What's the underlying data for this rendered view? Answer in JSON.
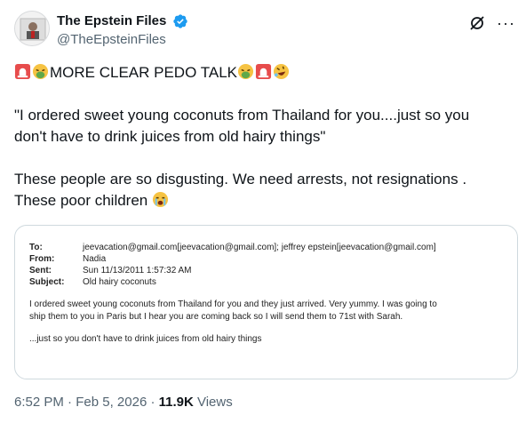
{
  "author": {
    "display_name": "The Epstein Files",
    "handle": "@TheEpsteinFiles",
    "verified_icon": "verified-badge-icon",
    "badge_color": "#1d9bf0"
  },
  "post": {
    "line1": "MORE CLEAR PEDO TALK",
    "line2": "\"I ordered sweet young coconuts from Thailand for you....just so you",
    "line3": "don't have to drink juices from old hairy things\"",
    "line4": "These people are so disgusting. We need arrests, not resignations .",
    "line5": "These poor children"
  },
  "document": {
    "to_label": "To:",
    "to_value": "jeevacation@gmail.com[jeevacation@gmail.com]; jeffrey epstein[jeevacation@gmail.com]",
    "from_label": "From:",
    "from_value": "Nadia",
    "sent_label": "Sent:",
    "sent_value": "Sun 11/13/2011 1:57:32 AM",
    "subject_label": "Subject:",
    "subject_value": "Old hairy coconuts",
    "body_line1": "I ordered sweet young coconuts from Thailand for you and they just arrived. Very yummy. I was going to",
    "body_line2": "ship them to you in Paris but I hear you are coming back so I will send them to 71st with Sarah.",
    "body_line3": "...just so you don't have to drink juices from old hairy things"
  },
  "meta": {
    "time": "6:52 PM",
    "sep1": " · ",
    "date": "Feb 5, 2026",
    "sep2": " · ",
    "views_count": "11.9K",
    "views_label": " Views"
  }
}
